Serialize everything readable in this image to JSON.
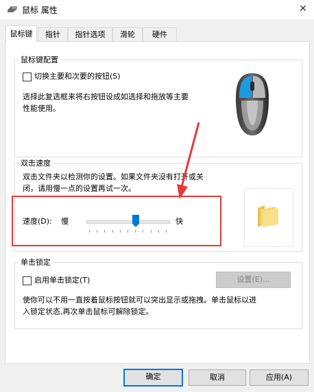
{
  "window": {
    "title": "鼠标 属性",
    "close_glyph": "✕"
  },
  "tabs": [
    {
      "label": "鼠标键",
      "active": true
    },
    {
      "label": "指针"
    },
    {
      "label": "指针选项"
    },
    {
      "label": "滑轮"
    },
    {
      "label": "硬件"
    }
  ],
  "button_config": {
    "group_label": "鼠标键配置",
    "checkbox_label": "切换主要和次要的按钮(S)",
    "checked": false,
    "description_line1": "选择此复选框来将右按钮设成如选择和拖放等主要",
    "description_line2": "性能使用。"
  },
  "double_click": {
    "group_label": "双击速度",
    "description_line1": "双击文件夹以检测你的设置。如果文件夹没有打开或关",
    "description_line2": "闭，请用慢一点的设置再试一次。",
    "speed_label": "速度(D):",
    "slow_label": "慢",
    "fast_label": "快",
    "speed_value": 0.6
  },
  "click_lock": {
    "group_label": "单击锁定",
    "checkbox_label": "启用单击锁定(T)",
    "checked": false,
    "settings_button": "设置(E)...",
    "description_line1": "使你可以不用一直按着鼠标按钮就可以突出显示或拖拽。单击鼠标以进",
    "description_line2": "入锁定状态,再次单击鼠标可解除锁定。"
  },
  "footer": {
    "ok": "确定",
    "cancel": "取消",
    "apply": "应用(A)"
  },
  "colors": {
    "annotation_red": "#e63939",
    "mouse_button_blue": "#1e9be0",
    "default_button_border": "#0078d7"
  }
}
